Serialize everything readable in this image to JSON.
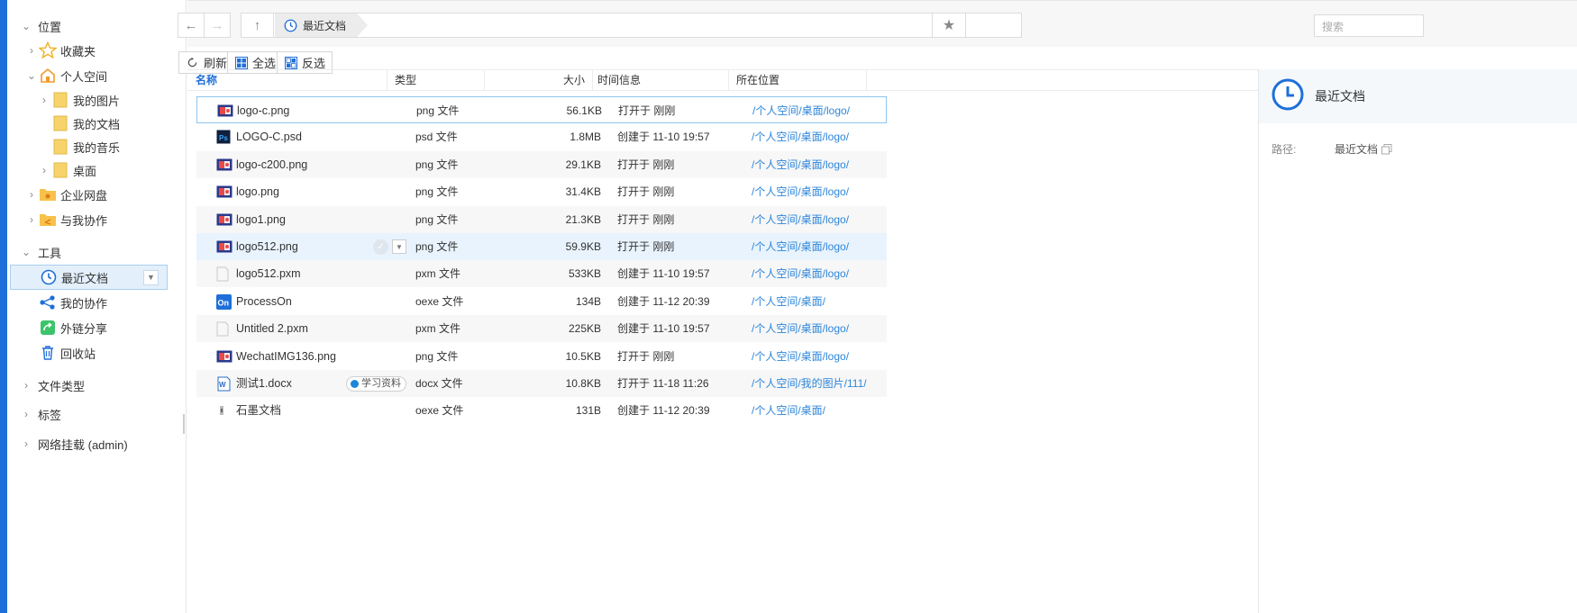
{
  "sidebar": {
    "location_section": "位置",
    "favorites": "收藏夹",
    "personal_space": "个人空间",
    "my_pictures": "我的图片",
    "my_documents": "我的文档",
    "my_music": "我的音乐",
    "desktop": "桌面",
    "enterprise_disk": "企业网盘",
    "shared_with_me": "与我协作",
    "tools_section": "工具",
    "recent_docs": "最近文档",
    "my_collab": "我的协作",
    "external_share": "外链分享",
    "recycle_bin": "回收站",
    "file_types": "文件类型",
    "tags": "标签",
    "network_mount": "网络挂载 (admin)"
  },
  "address": {
    "crumb": "最近文档",
    "search_placeholder": "搜索"
  },
  "toolbar": {
    "refresh": "刷新",
    "select_all": "全选",
    "invert": "反选"
  },
  "columns": {
    "name": "名称",
    "type": "类型",
    "size": "大小",
    "time": "时间信息",
    "location": "所在位置"
  },
  "files": [
    {
      "name": "logo-c.png",
      "type": "png 文件",
      "size": "56.1KB",
      "info": "打开于 刚刚",
      "loc": "/个人空间/桌面/logo/",
      "icon": "image-icon"
    },
    {
      "name": "LOGO-C.psd",
      "type": "psd 文件",
      "size": "1.8MB",
      "info": "创建于 11-10 19:57",
      "loc": "/个人空间/桌面/logo/",
      "icon": "psd-icon"
    },
    {
      "name": "logo-c200.png",
      "type": "png 文件",
      "size": "29.1KB",
      "info": "打开于 刚刚",
      "loc": "/个人空间/桌面/logo/",
      "icon": "image-icon"
    },
    {
      "name": "logo.png",
      "type": "png 文件",
      "size": "31.4KB",
      "info": "打开于 刚刚",
      "loc": "/个人空间/桌面/logo/",
      "icon": "image-icon"
    },
    {
      "name": "logo1.png",
      "type": "png 文件",
      "size": "21.3KB",
      "info": "打开于 刚刚",
      "loc": "/个人空间/桌面/logo/",
      "icon": "image-icon"
    },
    {
      "name": "logo512.png",
      "type": "png 文件",
      "size": "59.9KB",
      "info": "打开于 刚刚",
      "loc": "/个人空间/桌面/logo/",
      "icon": "image-icon"
    },
    {
      "name": "logo512.pxm",
      "type": "pxm 文件",
      "size": "533KB",
      "info": "创建于 11-10 19:57",
      "loc": "/个人空间/桌面/logo/",
      "icon": "blank-file-icon"
    },
    {
      "name": "ProcessOn",
      "type": "oexe 文件",
      "size": "134B",
      "info": "创建于 11-12 20:39",
      "loc": "/个人空间/桌面/",
      "icon": "processon-icon"
    },
    {
      "name": "Untitled 2.pxm",
      "type": "pxm 文件",
      "size": "225KB",
      "info": "创建于 11-10 19:57",
      "loc": "/个人空间/桌面/logo/",
      "icon": "blank-file-icon"
    },
    {
      "name": "WechatIMG136.png",
      "type": "png 文件",
      "size": "10.5KB",
      "info": "打开于 刚刚",
      "loc": "/个人空间/桌面/logo/",
      "icon": "image-icon"
    },
    {
      "name": "测试1.docx",
      "type": "docx 文件",
      "size": "10.8KB",
      "info": "打开于 11-18 11:26",
      "loc": "/个人空间/我的图片/111/",
      "icon": "word-icon",
      "tag": "学习资料"
    },
    {
      "name": "石墨文档",
      "type": "oexe 文件",
      "size": "131B",
      "info": "创建于 11-12 20:39",
      "loc": "/个人空间/桌面/",
      "icon": "shimo-icon"
    }
  ],
  "panel": {
    "title": "最近文档",
    "path_label": "路径:",
    "path_value": "最近文档"
  },
  "colors": {
    "accent": "#1e6fd9",
    "link": "#2e86d9",
    "folder": "#f7d36b",
    "selection_border": "#8cc6f0"
  }
}
